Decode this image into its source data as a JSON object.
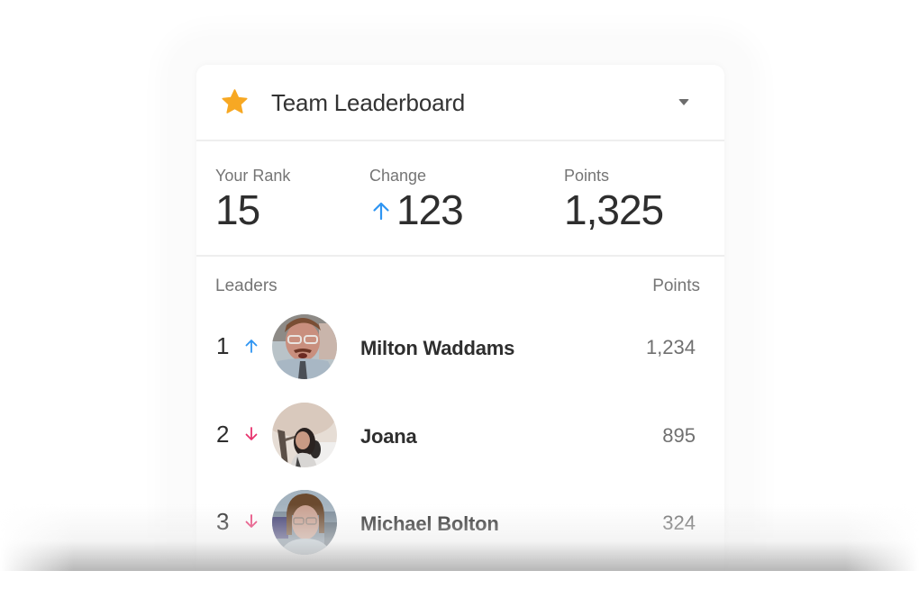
{
  "header": {
    "title": "Team Leaderboard",
    "icon": "star-icon",
    "icon_color": "#F7A823",
    "dropdown_icon": "caret-down-icon"
  },
  "stats": {
    "rank": {
      "label": "Your Rank",
      "value": "15"
    },
    "change": {
      "label": "Change",
      "value": "123",
      "direction": "up",
      "icon": "arrow-up-icon"
    },
    "points": {
      "label": "Points",
      "value": "1,325"
    }
  },
  "leaders": {
    "header_label": "Leaders",
    "points_label": "Points",
    "rows": [
      {
        "rank": "1",
        "trend": "up",
        "trend_icon": "arrow-up-icon",
        "name": "Milton Waddams",
        "points": "1,234",
        "avatar": "avatar-milton"
      },
      {
        "rank": "2",
        "trend": "down",
        "trend_icon": "arrow-down-icon",
        "name": "Joana",
        "points": "895",
        "avatar": "avatar-joana"
      },
      {
        "rank": "3",
        "trend": "down",
        "trend_icon": "arrow-down-icon",
        "name": "Michael Bolton",
        "points": "324",
        "avatar": "avatar-michael"
      }
    ]
  },
  "colors": {
    "up": "#2F95F2",
    "down": "#E8336E",
    "star": "#F7A823"
  }
}
